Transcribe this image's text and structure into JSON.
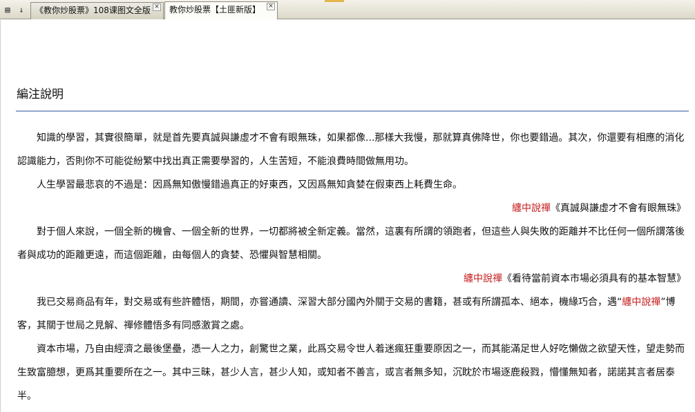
{
  "tabs": [
    {
      "label": "《教你炒股票》108课图文全版",
      "close_label": "×",
      "active": false
    },
    {
      "label": "教你炒股票【土匪新版】",
      "close_label": "×",
      "active": true
    }
  ],
  "toolbar": {
    "grid_label": "▤",
    "sort_label": "↓"
  },
  "colors": {
    "accent": "#c41818",
    "rule": "#92a8cc"
  },
  "doc": {
    "title": "編注說明",
    "p1": "知識的學習，其實很簡單，就是首先要真誠與謙虛才不會有眼無珠，如果都像...那樣大我慢，那就算真佛降世，你也要錯過。其次，你還要有相應的消化認識能力，否則你不可能從紛繁中找出真正需要學習的，人生苦短，不能浪費時間做無用功。",
    "p2": "人生學習最悲哀的不過是：因爲無知傲慢錯過真正的好東西，又因爲無知貪婪在假東西上耗費生命。",
    "q1_source": "纏中說禪",
    "q1_title": "《真誠與謙虛才不會有眼無珠》",
    "p3": "對于個人來說，一個全新的機會、一個全新的世界，一切都將被全新定義。當然，這裏有所謂的領跑者，但這些人與失敗的距離并不比任何一個所謂落後者與成功的距離更遠，而這個距離，由每個人的貪婪、恐懼與智慧相關。",
    "q2_source": "纏中說禪",
    "q2_title": "《看待當前資本市場必須具有的基本智慧》",
    "p4_before": "我已交易商品有年，對交易或有些許體悟，期間，亦嘗通讀、深習大部分國內外關于交易的書籍，甚或有所謂孤本、絕本，機緣巧合，遇",
    "p4_quote_open": "“",
    "p4_red": "纏中說禪",
    "p4_quote_close": "”",
    "p4_after": "博客，其關于世局之見解、禪修體悟多有同感激賞之處。",
    "p5": "資本市場，乃自由經濟之最後堡壘，憑一人之力，創驚世之業，此爲交易令世人着迷瘋狂重要原因之一，而其能滿足世人好吃懶做之欲望天性，望走勢而生致富臆想，更爲其重要所在之一。其中三昧，甚少人言，甚少人知，或知者不善言，或言者無多知，沉眈於市場逐鹿殺戮，懵懂無知者，諾諾其言者居泰半。"
  }
}
